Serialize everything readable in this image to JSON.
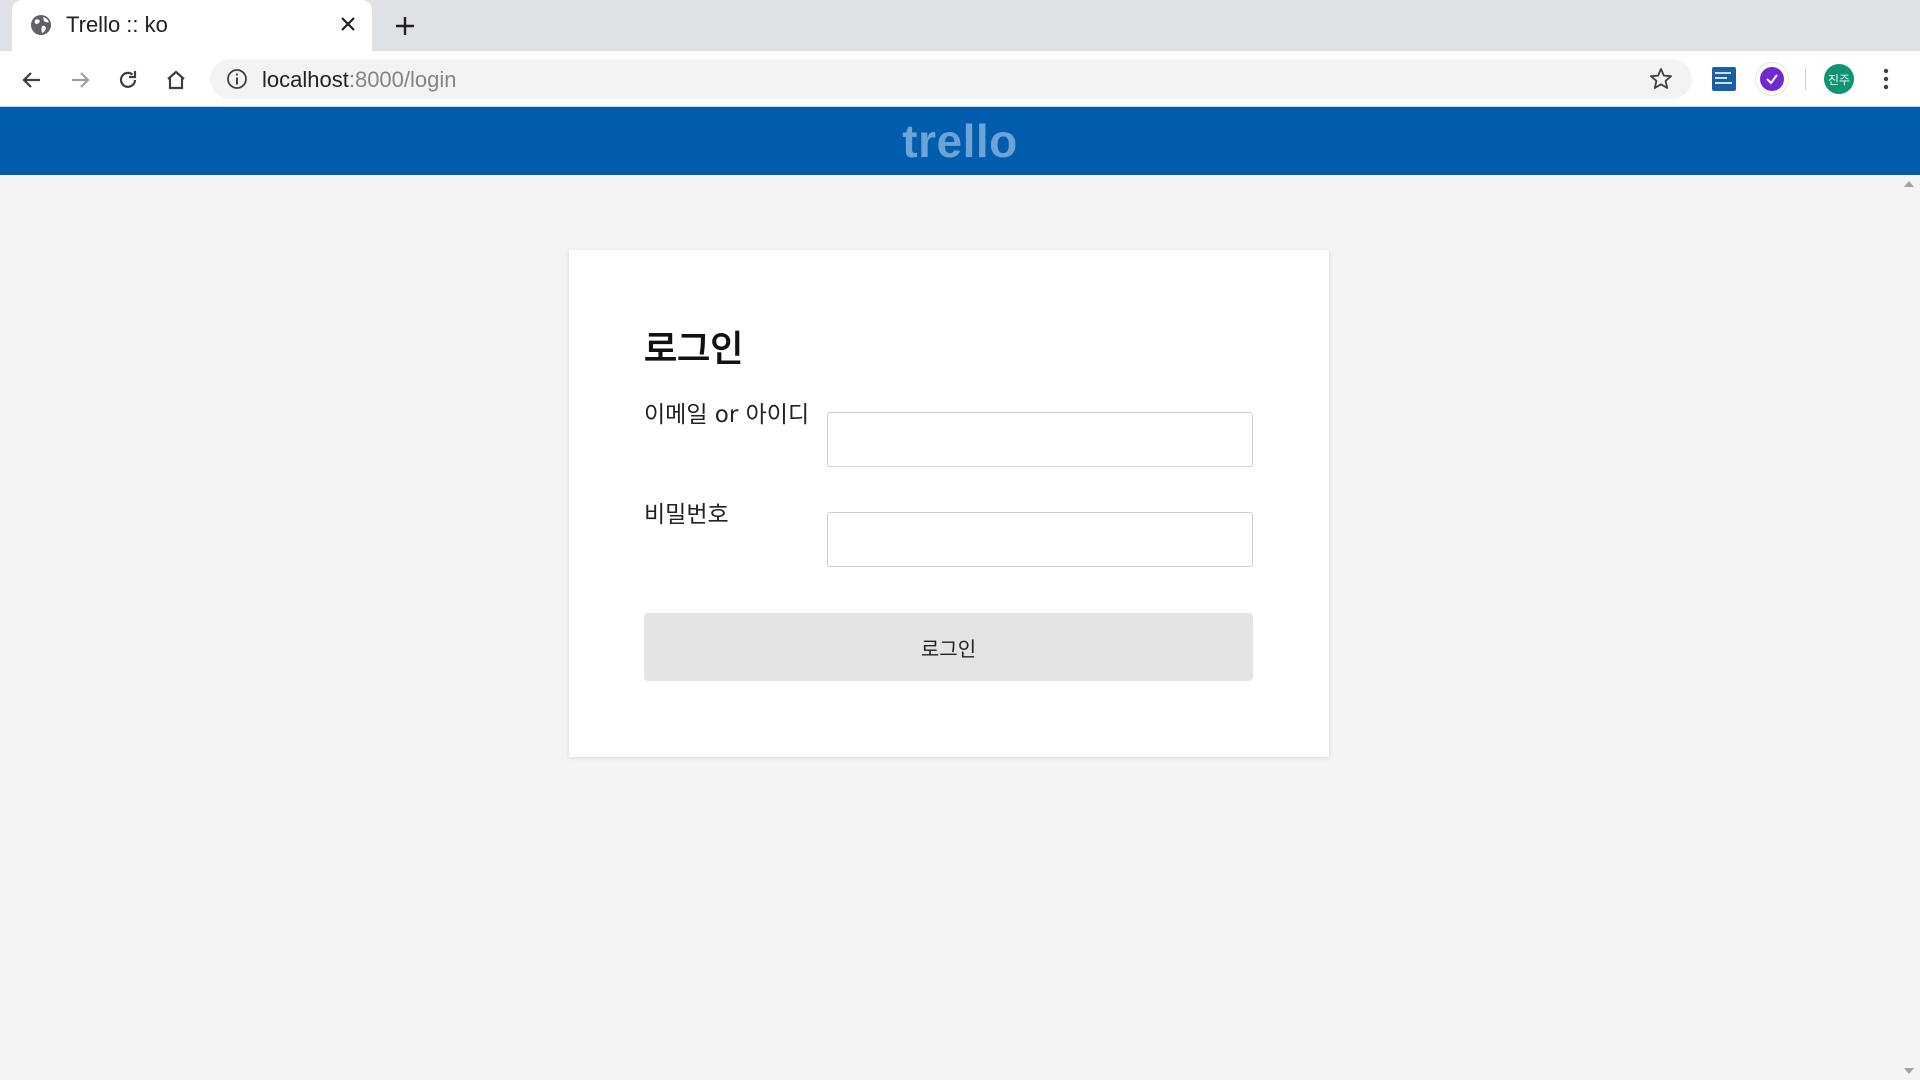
{
  "browser": {
    "tab": {
      "title": "Trello :: ko",
      "favicon": "globe-icon",
      "close_icon": "close-icon"
    },
    "new_tab_icon": "plus-icon",
    "nav": {
      "back_icon": "back-arrow-icon",
      "forward_icon": "forward-arrow-icon",
      "reload_icon": "reload-icon",
      "home_icon": "home-icon"
    },
    "address": {
      "host": "localhost",
      "rest": ":8000/login",
      "info_icon": "info-icon",
      "bookmark_icon": "star-icon"
    },
    "extensions": [
      "dictionary-extension-icon",
      "check-extension-icon"
    ],
    "profile": {
      "initials": "진주",
      "color": "#0e9373"
    },
    "menu_icon": "kebab-menu-icon"
  },
  "header": {
    "logo": "trello",
    "background": "#005cac",
    "logo_color": "#6ea3d8"
  },
  "login": {
    "title": "로그인",
    "email_label": "이메일 or 아이디",
    "email_value": "",
    "password_label": "비밀번호",
    "password_value": "",
    "submit_label": "로그인"
  }
}
